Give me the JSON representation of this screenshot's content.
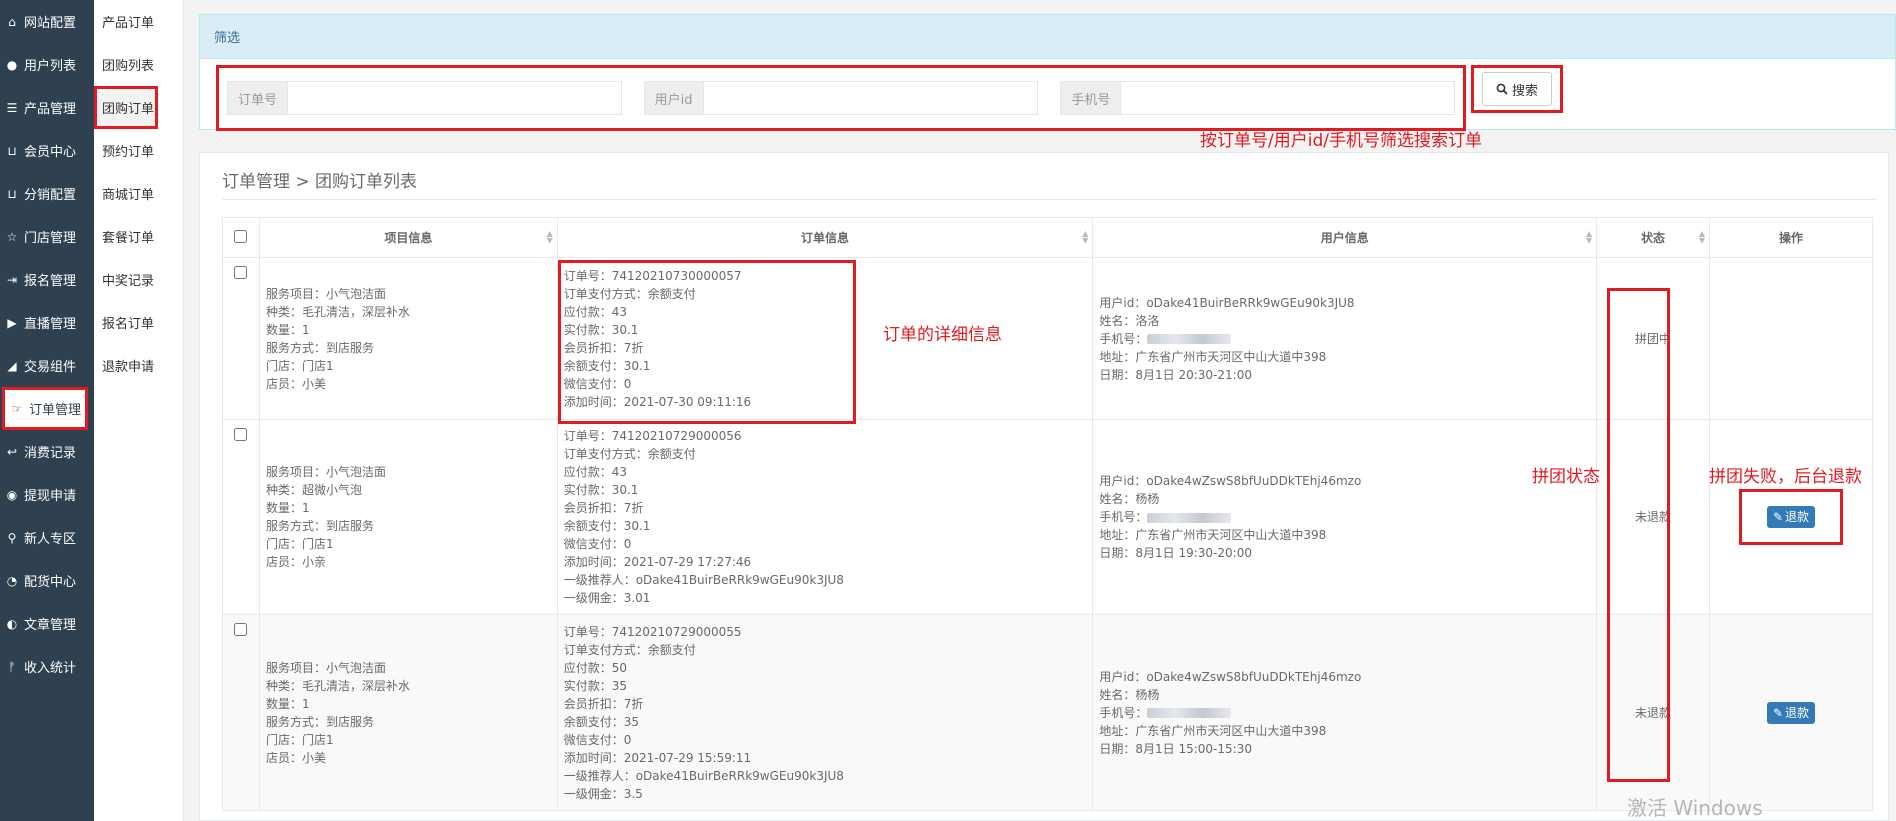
{
  "sidebar": {
    "items": [
      {
        "label": "网站配置",
        "icon": "home-icon"
      },
      {
        "label": "用户列表",
        "icon": "user-icon"
      },
      {
        "label": "产品管理",
        "icon": "list-icon"
      },
      {
        "label": "会员中心",
        "icon": "cart-icon"
      },
      {
        "label": "分销配置",
        "icon": "cart-icon"
      },
      {
        "label": "门店管理",
        "icon": "star-icon"
      },
      {
        "label": "报名管理",
        "icon": "signin-icon"
      },
      {
        "label": "直播管理",
        "icon": "video-icon"
      },
      {
        "label": "交易组件",
        "icon": "eraser-icon"
      },
      {
        "label": "订单管理",
        "icon": "hand-icon",
        "active": true
      },
      {
        "label": "消费记录",
        "icon": "reply-icon"
      },
      {
        "label": "提现申请",
        "icon": "wechat-icon"
      },
      {
        "label": "新人专区",
        "icon": "map-marker-icon"
      },
      {
        "label": "配货中心",
        "icon": "pie-chart-icon"
      },
      {
        "label": "文章管理",
        "icon": "adjust-icon"
      },
      {
        "label": "收入统计",
        "icon": "branch-icon"
      }
    ]
  },
  "submenu": {
    "items": [
      {
        "label": "产品订单"
      },
      {
        "label": "团购列表"
      },
      {
        "label": "团购订单",
        "active": true
      },
      {
        "label": "预约订单"
      },
      {
        "label": "商城订单"
      },
      {
        "label": "套餐订单"
      },
      {
        "label": "中奖记录"
      },
      {
        "label": "报名订单"
      },
      {
        "label": "退款申请"
      }
    ]
  },
  "filter": {
    "title": "筛选",
    "order_no_label": "订单号",
    "user_id_label": "用户id",
    "phone_label": "手机号",
    "search_label": "搜索"
  },
  "notes": {
    "filter_note": "按订单号/用户id/手机号筛选搜索订单",
    "detail_note": "订单的详细信息",
    "status_note": "拼团状态",
    "refund_note": "拼团失败，后台退款"
  },
  "list": {
    "breadcrumb": "订单管理 > 团购订单列表",
    "columns": [
      "项目信息",
      "订单信息",
      "用户信息",
      "状态",
      "操作"
    ],
    "refund_label": "退款",
    "rows": [
      {
        "project": [
          "服务项目：小气泡洁面",
          "种类：毛孔清洁，深层补水",
          "数量：1",
          "服务方式：到店服务",
          "门店：门店1",
          "店员：小美"
        ],
        "order": [
          "订单号：74120210730000057",
          "订单支付方式：余额支付",
          "应付款：43",
          "实付款：30.1",
          "会员折扣：7折",
          "余额支付：30.1",
          "微信支付：0",
          "添加时间：2021-07-30 09:11:16"
        ],
        "user_id": "用户id：oDake41BuirBeRRk9wGEu90k3JU8",
        "user_name": "姓名：洛洛",
        "user_phone": "手机号：",
        "user_address": "地址：广东省广州市天河区中山大道中398",
        "user_date": "日期：8月1日 20:30-21:00",
        "status": "拼团中",
        "has_refund": false
      },
      {
        "project": [
          "服务项目：小气泡洁面",
          "种类：超微小气泡",
          "数量：1",
          "服务方式：到店服务",
          "门店：门店1",
          "店员：小亲"
        ],
        "order": [
          "订单号：74120210729000056",
          "订单支付方式：余额支付",
          "应付款：43",
          "实付款：30.1",
          "会员折扣：7折",
          "余额支付：30.1",
          "微信支付：0",
          "添加时间：2021-07-29 17:27:46",
          "一级推荐人：oDake41BuirBeRRk9wGEu90k3JU8",
          "一级佣金：3.01"
        ],
        "user_id": "用户id：oDake4wZswS8bfUuDDkTEhj46mzo",
        "user_name": "姓名：杨杨",
        "user_phone": "手机号：",
        "user_address": "地址：广东省广州市天河区中山大道中398",
        "user_date": "日期：8月1日 19:30-20:00",
        "status": "未退款",
        "has_refund": true
      },
      {
        "project": [
          "服务项目：小气泡洁面",
          "种类：毛孔清洁，深层补水",
          "数量：1",
          "服务方式：到店服务",
          "门店：门店1",
          "店员：小美"
        ],
        "order": [
          "订单号：74120210729000055",
          "订单支付方式：余额支付",
          "应付款：50",
          "实付款：35",
          "会员折扣：7折",
          "余额支付：35",
          "微信支付：0",
          "添加时间：2021-07-29 15:59:11",
          "一级推荐人：oDake41BuirBeRRk9wGEu90k3JU8",
          "一级佣金：3.5"
        ],
        "user_id": "用户id：oDake4wZswS8bfUuDDkTEhj46mzo",
        "user_name": "姓名：杨杨",
        "user_phone": "手机号：",
        "user_address": "地址：广东省广州市天河区中山大道中398",
        "user_date": "日期：8月1日 15:00-15:30",
        "status": "未退款",
        "has_refund": true
      }
    ]
  },
  "watermark": "激活 Windows"
}
